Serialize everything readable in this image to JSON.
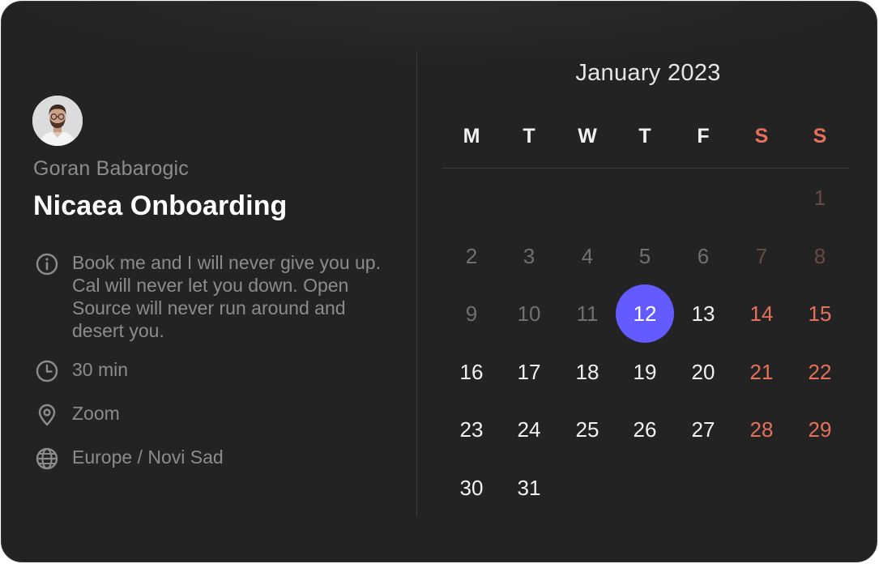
{
  "host": {
    "name": "Goran Babarogic",
    "avatar_alt": "host-avatar"
  },
  "event": {
    "title": "Nicaea Onboarding",
    "description": "Book me and I will never give you up. Cal will never let you down. Open Source will never run around and desert you.",
    "duration": "30 min",
    "location": "Zoom",
    "timezone": "Europe / Novi Sad"
  },
  "icons": {
    "description": "info-icon",
    "duration": "clock-icon",
    "location": "map-pin-icon",
    "timezone": "globe-icon"
  },
  "calendar": {
    "month_label": "January 2023",
    "weekdays": [
      "M",
      "T",
      "W",
      "T",
      "F",
      "S",
      "S"
    ],
    "first_day_column": 6,
    "days_in_month": 31,
    "today": 12,
    "selected_day": 12,
    "colors": {
      "accent": "#635bff",
      "weekend": "#e5705b",
      "text": "#f2f2f2",
      "muted": "#707070",
      "background": "#232323"
    }
  }
}
